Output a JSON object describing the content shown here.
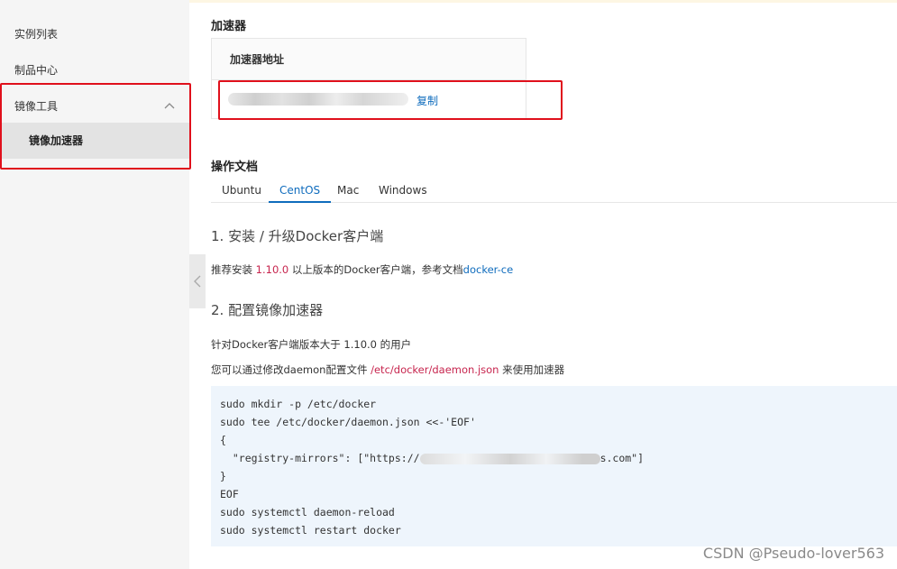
{
  "sidebar": {
    "items": [
      {
        "label": "实例列表"
      },
      {
        "label": "制品中心"
      },
      {
        "label": "镜像工具"
      },
      {
        "label": "镜像加速器"
      }
    ]
  },
  "accelerator": {
    "section_title": "加速器",
    "table_header": "加速器地址",
    "copy_label": "复制"
  },
  "docs": {
    "section_title": "操作文档",
    "tabs": [
      {
        "label": "Ubuntu",
        "active": false
      },
      {
        "label": "CentOS",
        "active": true
      },
      {
        "label": "Mac",
        "active": false
      },
      {
        "label": "Windows",
        "active": false
      }
    ],
    "step1_title": "1. 安装 / 升级Docker客户端",
    "step1_text_a": "推荐安装 ",
    "step1_version": "1.10.0",
    "step1_text_b": " 以上版本的Docker客户端，参考文档",
    "step1_link": "docker-ce",
    "step2_title": "2. 配置镜像加速器",
    "step2_line1": "针对Docker客户端版本大于 1.10.0 的用户",
    "step2_line2_a": "您可以通过修改daemon配置文件 ",
    "step2_path": "/etc/docker/daemon.json",
    "step2_line2_b": " 来使用加速器",
    "code": {
      "line1": "sudo mkdir -p /etc/docker",
      "line2": "sudo tee /etc/docker/daemon.json <<-'EOF'",
      "line3": "{",
      "line4_a": "  \"registry-mirrors\": [\"https://",
      "line4_b": "s.com\"]",
      "line5": "}",
      "line6": "EOF",
      "line7": "sudo systemctl daemon-reload",
      "line8": "sudo systemctl restart docker"
    }
  },
  "watermark": "CSDN @Pseudo-lover563",
  "colors": {
    "accent": "#0f6cbd",
    "highlight_box": "#e0101c",
    "path_text": "#c7254e"
  }
}
